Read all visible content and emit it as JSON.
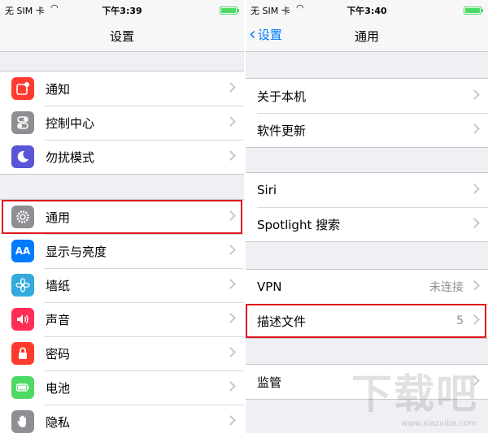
{
  "left": {
    "status": {
      "carrier": "无 SIM 卡",
      "time": "下午3:39"
    },
    "nav_title": "设置",
    "groups": [
      [
        {
          "label": "通知",
          "icon": "notifications-icon",
          "color": "#ff3b30"
        },
        {
          "label": "控制中心",
          "icon": "control-center-icon",
          "color": "#8e8e93"
        },
        {
          "label": "勿扰模式",
          "icon": "moon-icon",
          "color": "#5856d6"
        }
      ],
      [
        {
          "label": "通用",
          "icon": "gear-icon",
          "color": "#8e8e93"
        },
        {
          "label": "显示与亮度",
          "icon": "display-aa-icon",
          "color": "#007aff"
        },
        {
          "label": "墙纸",
          "icon": "wallpaper-flower-icon",
          "color": "#34aadc"
        },
        {
          "label": "声音",
          "icon": "speaker-icon",
          "color": "#ff2d55"
        },
        {
          "label": "密码",
          "icon": "lock-icon",
          "color": "#ff3b30"
        },
        {
          "label": "电池",
          "icon": "battery-icon",
          "color": "#4cd964"
        },
        {
          "label": "隐私",
          "icon": "hand-icon",
          "color": "#8e8e93"
        }
      ]
    ]
  },
  "right": {
    "status": {
      "carrier": "无 SIM 卡",
      "time": "下午3:40"
    },
    "back_label": "设置",
    "nav_title": "通用",
    "groups": [
      [
        {
          "label": "关于本机"
        },
        {
          "label": "软件更新"
        }
      ],
      [
        {
          "label": "Siri"
        },
        {
          "label": "Spotlight 搜索"
        }
      ],
      [
        {
          "label": "VPN",
          "value": "未连接"
        },
        {
          "label": "描述文件",
          "value": "5"
        }
      ],
      [
        {
          "label": "监管"
        }
      ]
    ]
  },
  "watermark": {
    "text": "下载吧",
    "url": "www.xiazaiba.com"
  },
  "colors": {
    "accent": "#007aff",
    "highlight": "#e1171e",
    "battery": "#4cd964"
  }
}
